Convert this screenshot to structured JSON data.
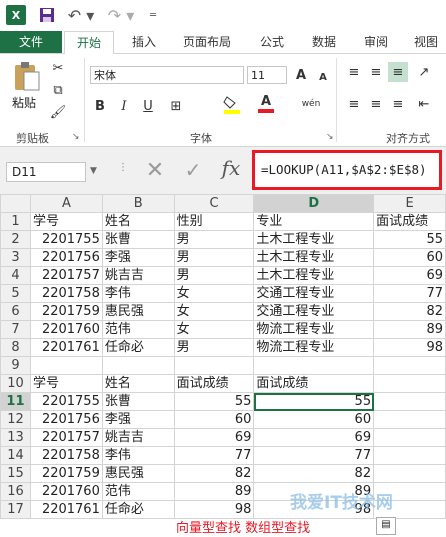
{
  "app": {
    "logo_text": "X"
  },
  "ribbon_tabs": [
    "文件",
    "开始",
    "插入",
    "页面布局",
    "公式",
    "数据",
    "审阅",
    "视图"
  ],
  "ribbon": {
    "paste_label": "粘贴",
    "clipboard_label": "剪贴板",
    "font_name": "宋体",
    "font_size": "11",
    "font_label": "字体",
    "align_label": "对齐方式",
    "bold": "B",
    "italic": "I",
    "underline": "U",
    "wen_label": "wén",
    "a_label": "A",
    "font_color": "#e81a24",
    "fill_color": "#ffff00"
  },
  "formula_bar": {
    "name_box": "D11",
    "cancel_glyph": "✕",
    "enter_glyph": "✓",
    "fx": "fx",
    "formula": "=LOOKUP(A11,$A$2:$E$8)"
  },
  "columns": [
    "A",
    "B",
    "C",
    "D",
    "E"
  ],
  "rows": [
    {
      "n": "1",
      "a": "学号",
      "b": "姓名",
      "c": "性别",
      "d": "专业",
      "e": "面试成绩"
    },
    {
      "n": "2",
      "a": "2201755",
      "b": "张曹",
      "c": "男",
      "d": "土木工程专业",
      "e": "55"
    },
    {
      "n": "3",
      "a": "2201756",
      "b": "李强",
      "c": "男",
      "d": "土木工程专业",
      "e": "60"
    },
    {
      "n": "4",
      "a": "2201757",
      "b": "姚吉吉",
      "c": "男",
      "d": "土木工程专业",
      "e": "69"
    },
    {
      "n": "5",
      "a": "2201758",
      "b": "李伟",
      "c": "女",
      "d": "交通工程专业",
      "e": "77"
    },
    {
      "n": "6",
      "a": "2201759",
      "b": "惠民强",
      "c": "女",
      "d": "交通工程专业",
      "e": "82"
    },
    {
      "n": "7",
      "a": "2201760",
      "b": "范伟",
      "c": "女",
      "d": "物流工程专业",
      "e": "89"
    },
    {
      "n": "8",
      "a": "2201761",
      "b": "任命必",
      "c": "男",
      "d": "物流工程专业",
      "e": "98"
    },
    {
      "n": "9",
      "a": "",
      "b": "",
      "c": "",
      "d": "",
      "e": ""
    },
    {
      "n": "10",
      "a": "学号",
      "b": "姓名",
      "c": "面试成绩",
      "d": "面试成绩",
      "e": ""
    },
    {
      "n": "11",
      "a": "2201755",
      "b": "张曹",
      "c": "55",
      "d": "55",
      "e": ""
    },
    {
      "n": "12",
      "a": "2201756",
      "b": "李强",
      "c": "60",
      "d": "60",
      "e": ""
    },
    {
      "n": "13",
      "a": "2201757",
      "b": "姚吉吉",
      "c": "69",
      "d": "69",
      "e": ""
    },
    {
      "n": "14",
      "a": "2201758",
      "b": "李伟",
      "c": "77",
      "d": "77",
      "e": ""
    },
    {
      "n": "15",
      "a": "2201759",
      "b": "惠民强",
      "c": "82",
      "d": "82",
      "e": ""
    },
    {
      "n": "16",
      "a": "2201760",
      "b": "范伟",
      "c": "89",
      "d": "89",
      "e": ""
    },
    {
      "n": "17",
      "a": "2201761",
      "b": "任命必",
      "c": "98",
      "d": "98",
      "e": ""
    }
  ],
  "annotation": "向量型查找  数组型查找",
  "watermark": "我爱IT技术网"
}
